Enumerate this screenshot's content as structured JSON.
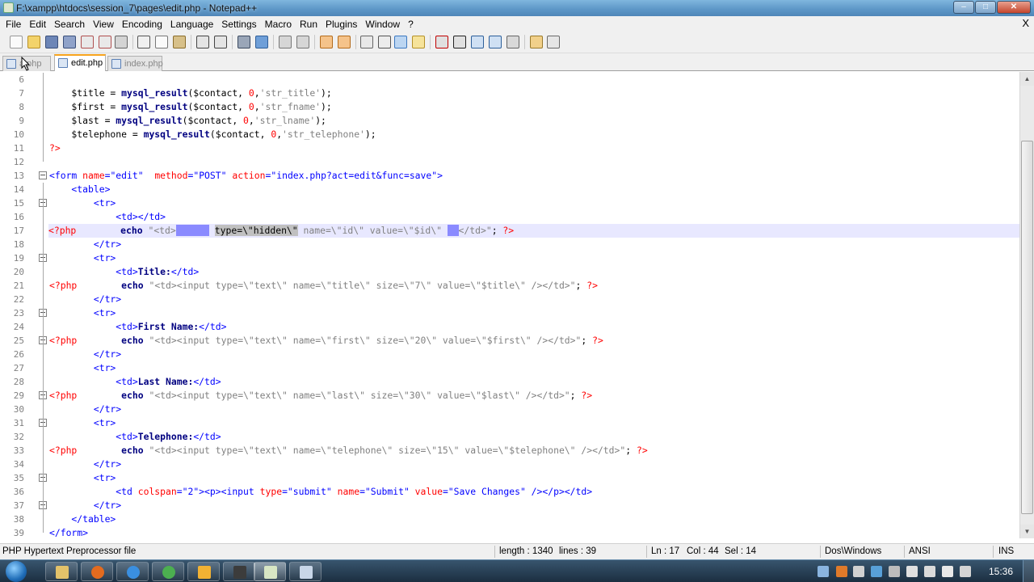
{
  "window": {
    "title": "F:\\xampp\\htdocs\\session_7\\pages\\edit.php - Notepad++",
    "min": "–",
    "max": "□",
    "close": "✕"
  },
  "menu": [
    "File",
    "Edit",
    "Search",
    "View",
    "Encoding",
    "Language",
    "Settings",
    "Macro",
    "Run",
    "Plugins",
    "Window",
    "?"
  ],
  "menu_close": "X",
  "toolbar_icons": [
    "new-file-icon",
    "open-file-icon",
    "save-icon",
    "save-all-icon",
    "close-icon",
    "close-all-icon",
    "print-icon",
    "cut-icon",
    "copy-icon",
    "paste-icon",
    "undo-icon",
    "redo-icon",
    "find-icon",
    "replace-icon",
    "zoom-in-icon",
    "zoom-out-icon",
    "sync-vertical-icon",
    "sync-horizontal-icon",
    "word-wrap-icon",
    "show-all-chars-icon",
    "indent-guide-icon",
    "user-lang-icon",
    "doc-map-icon",
    "record-macro-icon",
    "stop-macro-icon",
    "play-macro-icon",
    "run-macro-multiple-icon",
    "save-macro-icon",
    "spell-check-icon",
    "abc-icon"
  ],
  "tabs": [
    {
      "label": "a.php"
    },
    {
      "label": "edit.php",
      "active": true
    },
    {
      "label": "index.php"
    }
  ],
  "editor": {
    "line_numbers": [
      "6",
      "7",
      "8",
      "9",
      "10",
      "11",
      "12",
      "13",
      "14",
      "15",
      "16",
      "17",
      "18",
      "19",
      "20",
      "21",
      "22",
      "23",
      "24",
      "25",
      "26",
      "27",
      "28",
      "29",
      "30",
      "31",
      "32",
      "33",
      "34",
      "35",
      "36",
      "37",
      "38",
      "39"
    ],
    "current_line": "17"
  },
  "status": {
    "file_type": "PHP Hypertext Preprocessor file",
    "length": "length : 1340",
    "lines": "lines : 39",
    "ln": "Ln : 17",
    "col": "Col : 44",
    "sel": "Sel : 14",
    "eol": "Dos\\Windows",
    "encoding": "ANSI",
    "mode": "INS"
  },
  "taskbar": {
    "clock": "15:36"
  },
  "colors": {
    "keyword": "#000080",
    "tag": "#0000ff",
    "php_delim": "#ff0000",
    "string": "#808080",
    "highlight": "#8080ff"
  }
}
